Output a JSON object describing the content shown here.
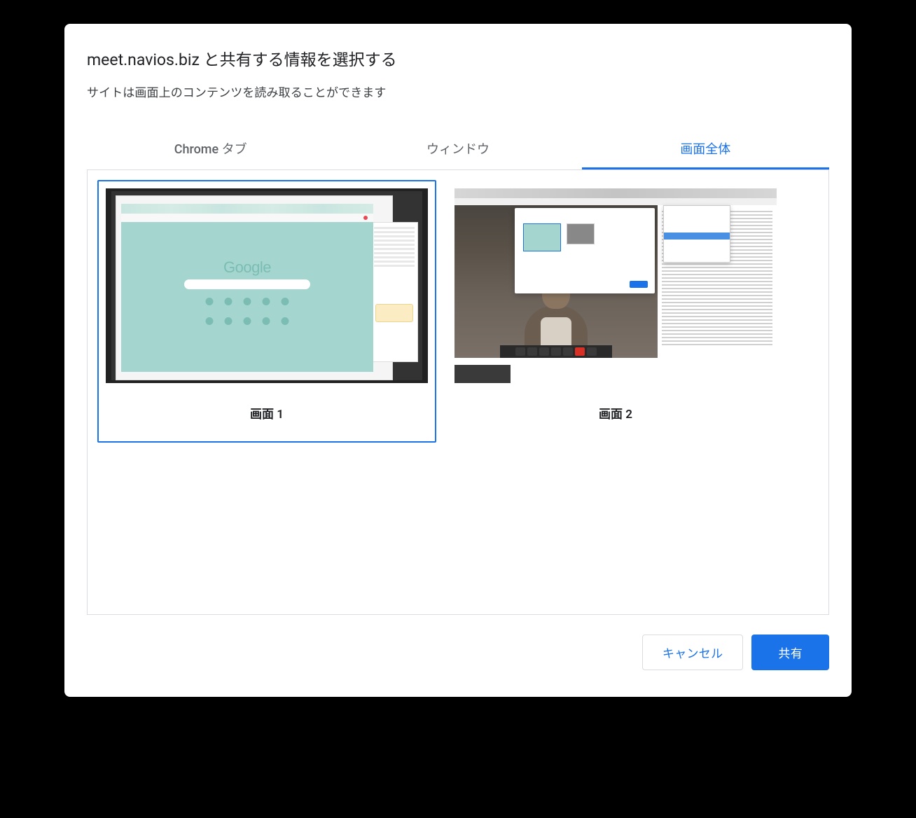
{
  "dialog": {
    "title": "meet.navios.biz と共有する情報を選択する",
    "subtitle": "サイトは画面上のコンテンツを読み取ることができます"
  },
  "tabs": [
    {
      "label": "Chrome タブ",
      "active": false
    },
    {
      "label": "ウィンドウ",
      "active": false
    },
    {
      "label": "画面全体",
      "active": true
    }
  ],
  "screens": [
    {
      "label": "画面 1",
      "selected": true
    },
    {
      "label": "画面 2",
      "selected": false
    }
  ],
  "thumbnail1": {
    "logo": "Google"
  },
  "footer": {
    "cancel": "キャンセル",
    "share": "共有"
  },
  "colors": {
    "accent": "#1a73e8",
    "text_primary": "#202124",
    "text_secondary": "#5f6368",
    "border": "#dadce0"
  }
}
